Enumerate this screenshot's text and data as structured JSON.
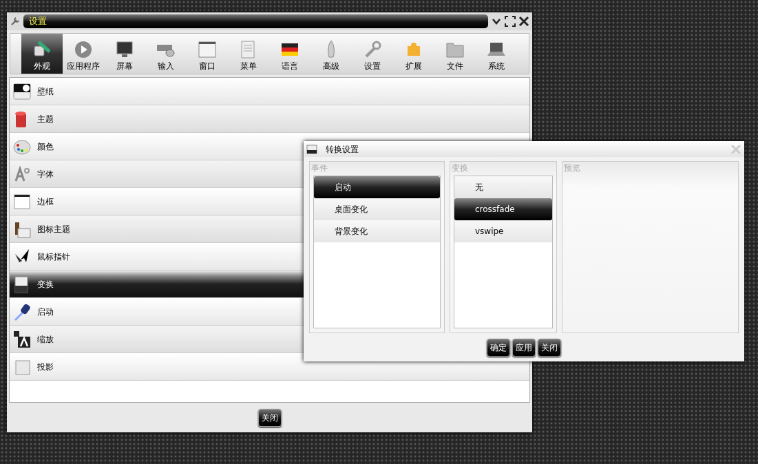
{
  "main_window": {
    "title": "设置",
    "toolbar": [
      {
        "label": "外观",
        "selected": true
      },
      {
        "label": "应用程序",
        "selected": false
      },
      {
        "label": "屏幕",
        "selected": false
      },
      {
        "label": "输入",
        "selected": false
      },
      {
        "label": "窗口",
        "selected": false
      },
      {
        "label": "菜单",
        "selected": false
      },
      {
        "label": "语言",
        "selected": false
      },
      {
        "label": "高级",
        "selected": false
      },
      {
        "label": "设置",
        "selected": false
      },
      {
        "label": "扩展",
        "selected": false
      },
      {
        "label": "文件",
        "selected": false
      },
      {
        "label": "系统",
        "selected": false
      }
    ],
    "items": [
      {
        "label": "壁纸",
        "selected": false
      },
      {
        "label": "主题",
        "selected": false
      },
      {
        "label": "颜色",
        "selected": false
      },
      {
        "label": "字体",
        "selected": false
      },
      {
        "label": "边框",
        "selected": false
      },
      {
        "label": "图标主题",
        "selected": false
      },
      {
        "label": "鼠标指针",
        "selected": false
      },
      {
        "label": "变换",
        "selected": true
      },
      {
        "label": "启动",
        "selected": false
      },
      {
        "label": "缩放",
        "selected": false
      },
      {
        "label": "投影",
        "selected": false
      }
    ],
    "close_button": "关闭"
  },
  "dialog": {
    "title": "转换设置",
    "events": {
      "heading": "事件",
      "items": [
        {
          "label": "启动",
          "selected": true
        },
        {
          "label": "桌面变化",
          "selected": false
        },
        {
          "label": "背景变化",
          "selected": false
        }
      ]
    },
    "transitions": {
      "heading": "变换",
      "items": [
        {
          "label": "无",
          "selected": false
        },
        {
          "label": "crossfade",
          "selected": true
        },
        {
          "label": "vswipe",
          "selected": false
        }
      ]
    },
    "preview": {
      "heading": "预览"
    },
    "buttons": [
      "确定",
      "应用",
      "关闭"
    ]
  }
}
